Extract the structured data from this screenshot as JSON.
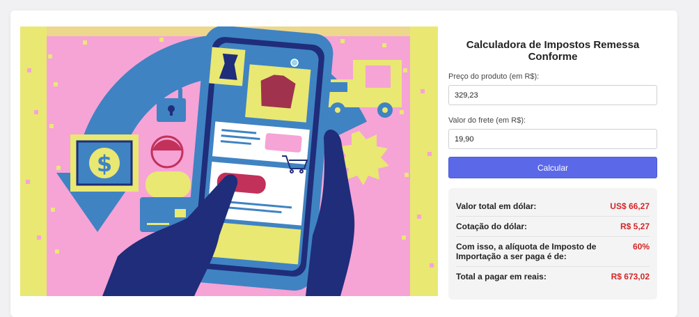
{
  "form": {
    "title": "Calculadora de Impostos Remessa Conforme",
    "price_label": "Preço do produto (em R$):",
    "price_value": "329,23",
    "freight_label": "Valor do frete (em R$):",
    "freight_value": "19,90",
    "submit_label": "Calcular"
  },
  "results": [
    {
      "label": "Valor total em dólar:",
      "value": "US$ 66,27"
    },
    {
      "label": "Cotação do dólar:",
      "value": "R$ 5,27"
    },
    {
      "label": "Com isso, a alíquota de Imposto de Importação a ser paga é de:",
      "value": "60%"
    },
    {
      "label": "Total a pagar em reais:",
      "value": "R$ 673,02"
    }
  ],
  "colors": {
    "accent": "#5b69e8",
    "result_value": "#d32626",
    "illustration_pink": "#f6a3d6",
    "illustration_blue": "#3f83c3",
    "illustration_navy": "#1f2d7a",
    "illustration_yellow": "#e9e873"
  },
  "illustration": {
    "icons": [
      "online-shopping-illustration",
      "smartphone-icon",
      "dollar-bill-icon",
      "padlock-icon",
      "delivery-truck-icon",
      "credit-card-icon",
      "shopping-cart-icon"
    ]
  }
}
